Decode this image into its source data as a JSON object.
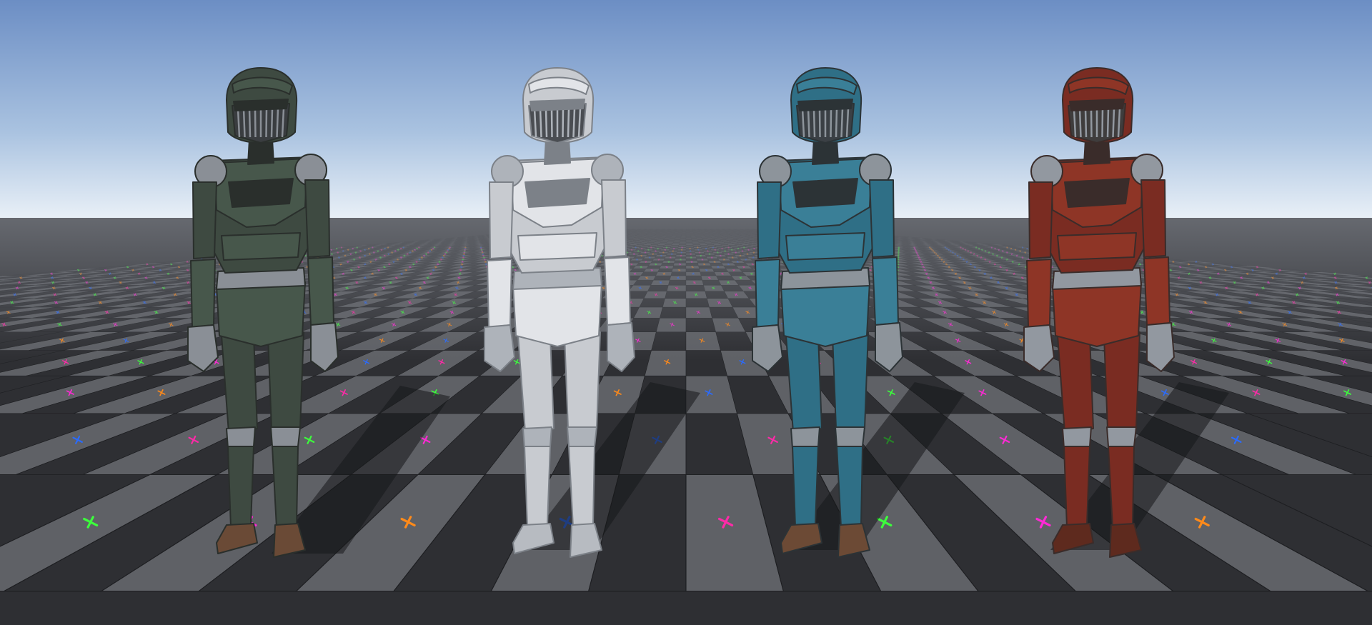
{
  "scene": {
    "colors": {
      "sky_top": "#6c8ec4",
      "sky_mid": "#a9c2e0",
      "sky_horizon": "#e9f0f7",
      "floor_far": "#70737a",
      "tile_light": "#5f6166",
      "tile_dark": "#2e2f33",
      "grid_line": "#1d1e21",
      "shadow": "#16171a"
    },
    "marker_colors": [
      "#ff2aa8",
      "#ff3b3b",
      "#ff8a1a",
      "#ffd21a",
      "#3cff3c",
      "#1ad2ff",
      "#2a6bff",
      "#a93bff",
      "#ff2ad5",
      "#19ff9c"
    ],
    "robots": [
      {
        "id": "green",
        "base": "#3e4a41",
        "plate": "#47574b",
        "dark": "#2a2f2c",
        "metal": "#8a8f96",
        "rust": "#6a4a36",
        "visor": "#3a3d40"
      },
      {
        "id": "white",
        "base": "#c8cbd0",
        "plate": "#e2e4e8",
        "dark": "#7c8188",
        "metal": "#aeb3ba",
        "rust": "#b7bbc1",
        "visor": "#4a4d52"
      },
      {
        "id": "blue",
        "base": "#2f6f86",
        "plate": "#3a7f97",
        "dark": "#2c3336",
        "metal": "#8d949b",
        "rust": "#6c4a35",
        "visor": "#3b4045"
      },
      {
        "id": "red",
        "base": "#7a2c22",
        "plate": "#8e3526",
        "dark": "#3a2c2a",
        "metal": "#9298a0",
        "rust": "#5e2a1e",
        "visor": "#3f3d3d"
      }
    ]
  }
}
